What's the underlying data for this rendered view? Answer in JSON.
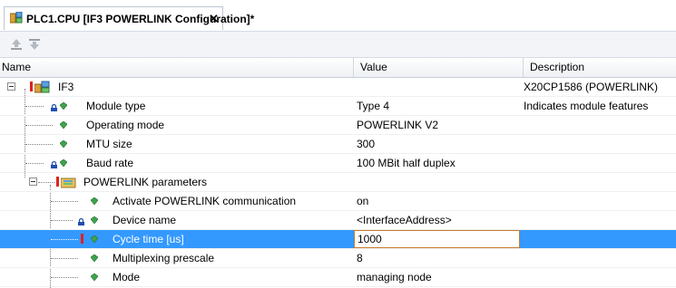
{
  "tab": {
    "title": "PLC1.CPU [IF3 POWERLINK Configuration]*",
    "close": "✕",
    "icon": "config-icon"
  },
  "toolbar": {
    "buttons": [
      {
        "icon": "move-up-icon"
      },
      {
        "icon": "move-down-icon"
      }
    ]
  },
  "columns": {
    "name": "Name",
    "value": "Value",
    "description": "Description"
  },
  "rows": [
    {
      "name": "IF3",
      "value": "",
      "description": "X20CP1586 (POWERLINK)"
    },
    {
      "name": "Module type",
      "value": "Type 4",
      "description": "Indicates module features"
    },
    {
      "name": "Operating mode",
      "value": "POWERLINK V2",
      "description": ""
    },
    {
      "name": "MTU size",
      "value": "300",
      "description": ""
    },
    {
      "name": "Baud rate",
      "value": "100 MBit half duplex",
      "description": ""
    },
    {
      "name": "POWERLINK parameters",
      "value": "",
      "description": ""
    },
    {
      "name": "Activate POWERLINK communication",
      "value": "on",
      "description": ""
    },
    {
      "name": "Device name",
      "value": "<InterfaceAddress>",
      "description": ""
    },
    {
      "name": "Cycle time [us]",
      "value": "1000",
      "description": ""
    },
    {
      "name": "Multiplexing prescale",
      "value": "8",
      "description": ""
    },
    {
      "name": "Mode",
      "value": "managing node",
      "description": ""
    }
  ],
  "colors": {
    "selection": "#3399ff",
    "gem": "#3fa34d",
    "lock": "#1f4fb0",
    "required": "#e02020",
    "edit_border": "#c87a2c"
  }
}
